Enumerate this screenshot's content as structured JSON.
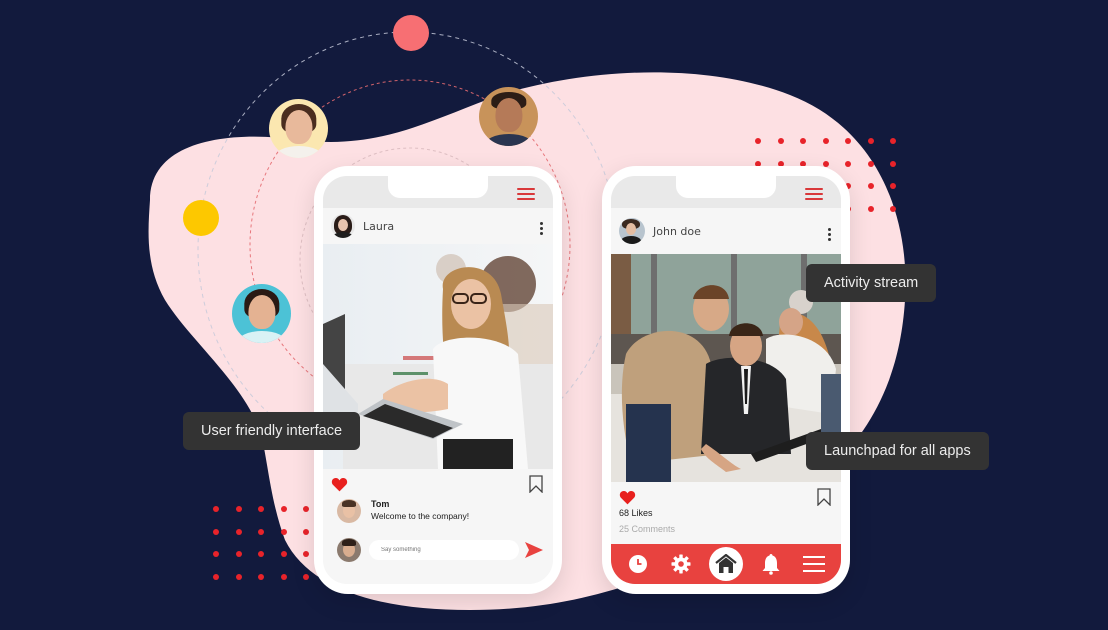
{
  "colors": {
    "background": "#121a3d",
    "blob": "#fde0e3",
    "accent_red": "#e8423f",
    "dot_red": "#e8232a",
    "salmon_dot": "#f76f73",
    "yellow_dot": "#fdc800",
    "callout_bg": "#333333",
    "callout_text": "#ececec"
  },
  "callouts": {
    "user_friendly": "User friendly interface",
    "activity_stream": "Activity stream",
    "launchpad": "Launchpad for all apps"
  },
  "phone_left": {
    "menu_icon": "hamburger-menu-icon",
    "post": {
      "user_name": "Laura",
      "options_icon": "kebab-menu-icon",
      "photo_alt": "Woman with glasses smiling at laptop in office",
      "like_icon": "heart-icon",
      "save_icon": "bookmark-icon"
    },
    "comment": {
      "author": "Tom",
      "text": "Welcome to the company!"
    },
    "reply": {
      "placeholder": "Say something",
      "send_icon": "send-icon"
    }
  },
  "phone_right": {
    "menu_icon": "hamburger-menu-icon",
    "post": {
      "user_name": "John doe",
      "options_icon": "kebab-menu-icon",
      "photo_alt": "Colleagues working together at a computer in office",
      "like_icon": "heart-icon",
      "save_icon": "bookmark-icon",
      "likes": "68 Likes",
      "comments": "25 Comments"
    },
    "bottom_nav": [
      {
        "name": "history",
        "icon": "clock-icon"
      },
      {
        "name": "settings",
        "icon": "gear-icon"
      },
      {
        "name": "home",
        "icon": "home-icon",
        "active": true
      },
      {
        "name": "notifications",
        "icon": "bell-icon"
      },
      {
        "name": "menu",
        "icon": "hamburger-menu-icon"
      }
    ]
  },
  "floating_avatars": [
    {
      "name": "woman-long-hair",
      "bg": "#fbe7b0"
    },
    {
      "name": "man-glasses",
      "bg": "#c8935a"
    },
    {
      "name": "woman-laughing",
      "bg": "#4cc2d6"
    }
  ]
}
